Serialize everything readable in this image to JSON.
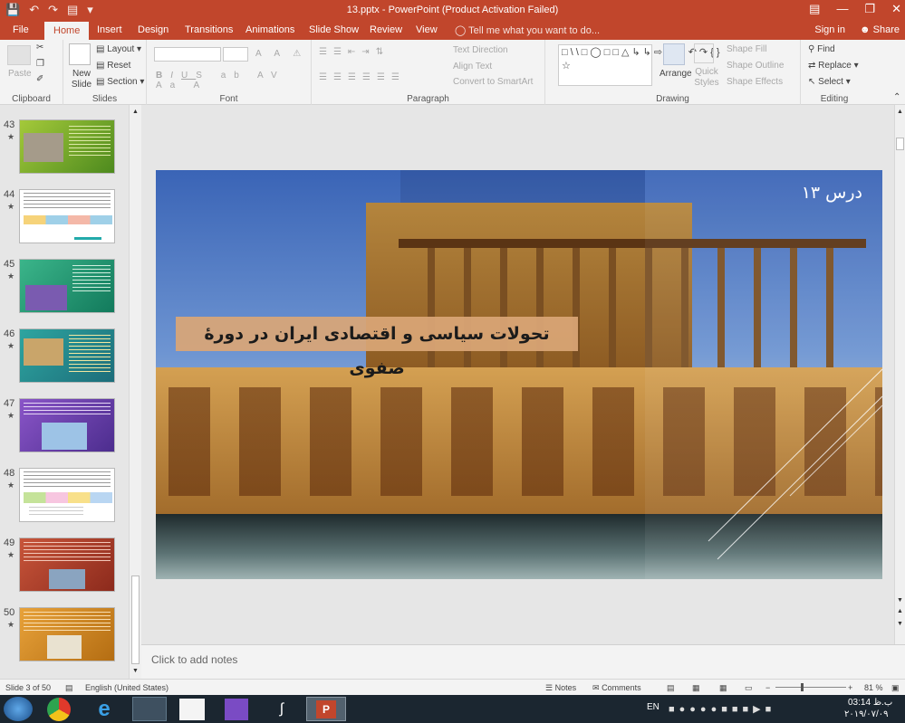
{
  "window": {
    "title": "13.pptx - PowerPoint (Product Activation Failed)"
  },
  "tabs": [
    "File",
    "Home",
    "Insert",
    "Design",
    "Transitions",
    "Animations",
    "Slide Show",
    "Review",
    "View"
  ],
  "active_tab": "Home",
  "tell_me": "Tell me what you want to do...",
  "account": {
    "sign_in": "Sign in",
    "share": "Share"
  },
  "ribbon": {
    "clipboard": {
      "label": "Clipboard",
      "paste": "Paste"
    },
    "slides": {
      "label": "Slides",
      "new_slide": "New Slide",
      "layout": "Layout",
      "reset": "Reset",
      "section": "Section"
    },
    "font": {
      "label": "Font"
    },
    "paragraph": {
      "label": "Paragraph",
      "text_direction": "Text Direction",
      "align_text": "Align Text",
      "smartart": "Convert to SmartArt"
    },
    "drawing": {
      "label": "Drawing",
      "arrange": "Arrange",
      "quick_styles": "Quick Styles",
      "shape_fill": "Shape Fill",
      "shape_outline": "Shape Outline",
      "shape_effects": "Shape Effects"
    },
    "editing": {
      "label": "Editing",
      "find": "Find",
      "replace": "Replace",
      "select": "Select"
    }
  },
  "thumbnails": [
    {
      "num": "43",
      "star": "★"
    },
    {
      "num": "44",
      "star": "★"
    },
    {
      "num": "45",
      "star": "★"
    },
    {
      "num": "46",
      "star": "★"
    },
    {
      "num": "47",
      "star": "★"
    },
    {
      "num": "48",
      "star": "★"
    },
    {
      "num": "49",
      "star": "★"
    },
    {
      "num": "50",
      "star": "★"
    }
  ],
  "slide": {
    "lesson": "درس ١٣",
    "title": "تحولات سیاسی و اقتصادی ایران در دورهٔ صفوی"
  },
  "notes_placeholder": "Click to add notes",
  "status": {
    "slide_info": "Slide 3 of 50",
    "language": "English (United States)",
    "notes": "Notes",
    "comments": "Comments",
    "zoom": "81 %"
  },
  "taskbar": {
    "lang": "EN",
    "time": "03:14",
    "ampm": "ب.ظ",
    "date": "٢٠١٩/٠٧/٠٩"
  },
  "colors": {
    "accent": "#c1462c",
    "title_band": "#d9a676"
  }
}
